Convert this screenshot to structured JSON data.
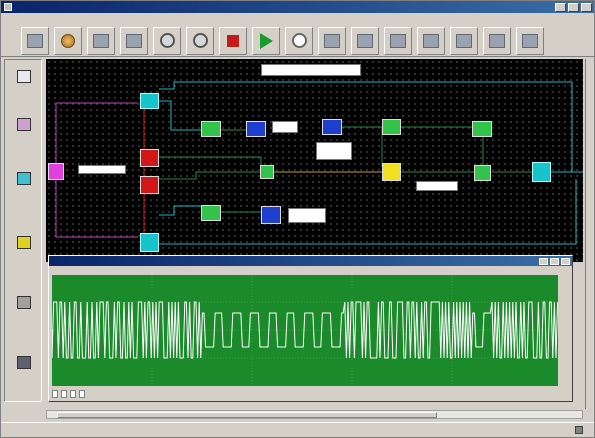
{
  "window": {
    "title": "",
    "minimize": "",
    "maximize": "",
    "close": ""
  },
  "menu": [
    "",
    "",
    "",
    "",
    "",
    "",
    "",
    "",
    "",
    "",
    "",
    ""
  ],
  "toolbar": {
    "buttons": [
      {
        "icon": "block-icon"
      },
      {
        "icon": "spin-icon"
      },
      {
        "icon": "block-icon"
      },
      {
        "icon": "block-icon"
      },
      {
        "icon": "target-icon"
      },
      {
        "icon": "target-icon"
      },
      {
        "icon": "stop-icon"
      },
      {
        "icon": "play-icon"
      },
      {
        "icon": "clock-icon"
      },
      {
        "icon": "grid-icon"
      },
      {
        "icon": "block-icon"
      },
      {
        "icon": "block-icon"
      },
      {
        "icon": "block-icon"
      },
      {
        "icon": "block-icon"
      },
      {
        "icon": "block-icon"
      },
      {
        "icon": "block-icon"
      }
    ]
  },
  "palette": [
    {
      "label": "",
      "color": "#e8e8f0"
    },
    {
      "label": "",
      "color": "#d0a0d0"
    },
    {
      "label": "",
      "color": "#40c0d0"
    },
    {
      "label": "",
      "color": "#e0d020"
    },
    {
      "label": "",
      "color": "#a0a0a0"
    },
    {
      "label": "",
      "color": "#606070"
    }
  ],
  "diagram": {
    "title_note": "",
    "notes": [
      "",
      "",
      "",
      "",
      "",
      "",
      ""
    ]
  },
  "scope": {
    "title": "",
    "menu": [
      "",
      "",
      ""
    ],
    "header_readout": "",
    "y_ticks": [
      "",
      "",
      "",
      "",
      ""
    ],
    "x_ticks": [
      "",
      "",
      "",
      ""
    ],
    "controls": [
      "",
      "",
      "",
      ""
    ],
    "trace_color": "#ffffff",
    "background_color": "#1b8a2a"
  },
  "status": {
    "message": "",
    "right": ""
  }
}
